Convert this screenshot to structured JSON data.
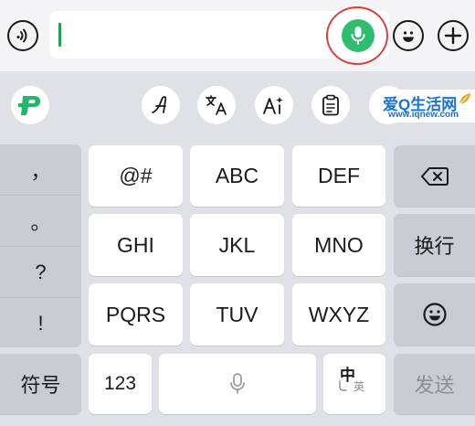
{
  "input_bar": {
    "text_value": "",
    "icons": [
      "voice-wave-icon",
      "microphone-icon",
      "emoji-icon",
      "plus-icon"
    ]
  },
  "toolbar": {
    "tools": [
      "keyboard-logo-icon",
      "handwriting-icon",
      "translate-icon",
      "ai-icon",
      "clipboard-icon"
    ],
    "watermark": {
      "title": "爱Q生活网",
      "url": "www.iqnew.com"
    }
  },
  "keyboard": {
    "punctuation": [
      "，",
      "。",
      "?",
      "!"
    ],
    "rows": [
      [
        "@#",
        "ABC",
        "DEF"
      ],
      [
        "GHI",
        "JKL",
        "MNO"
      ],
      [
        "PQRS",
        "TUV",
        "WXYZ"
      ]
    ],
    "newline_label": "换行",
    "symbols_label": "符号",
    "numbers_label": "123",
    "lang_main": "中",
    "lang_sub": "英",
    "send_label": "发送"
  },
  "colors": {
    "accent_green": "#2fbd6f",
    "highlight_ring": "#d64242",
    "watermark_blue": "#1773d6"
  }
}
